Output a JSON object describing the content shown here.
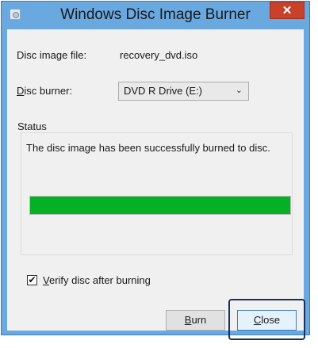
{
  "window": {
    "title": "Windows Disc Image Burner",
    "close_glyph": "✕"
  },
  "form": {
    "image_file_label": "Disc image file:",
    "image_file_value": "recovery_dvd.iso",
    "burner_label_mnemonic": "D",
    "burner_label_rest": "isc burner:",
    "burner_selected": "DVD R Drive (E:)"
  },
  "status": {
    "group_title": "Status",
    "message": "The disc image has been successfully burned to disc.",
    "progress_fraction": 1.0,
    "progress_color": "#06b025"
  },
  "verify": {
    "checked": true,
    "label_mnemonic": "V",
    "label_rest": "erify disc after burning"
  },
  "buttons": {
    "burn_mnemonic": "B",
    "burn_rest": "urn",
    "close_mnemonic": "C",
    "close_rest": "lose"
  }
}
